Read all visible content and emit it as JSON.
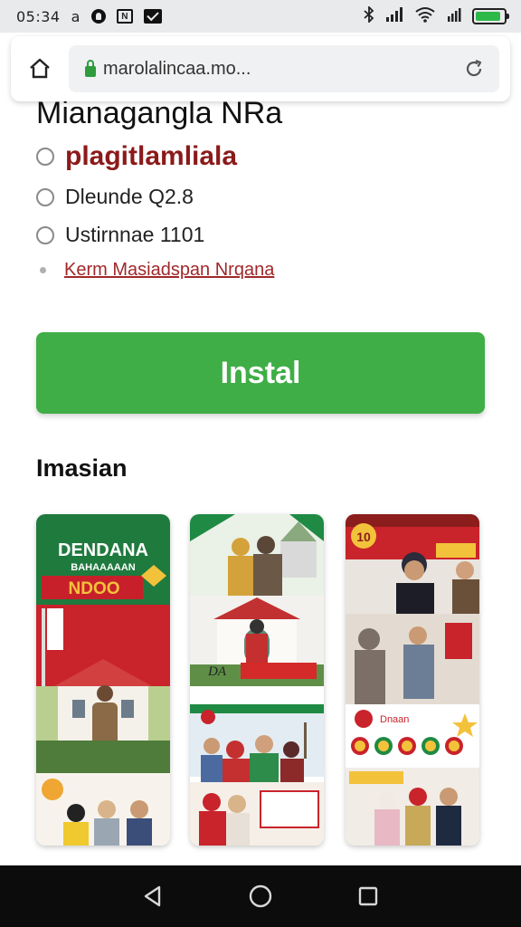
{
  "status_bar": {
    "time": "05:34",
    "letter": "a",
    "icons": [
      "notification-dot-icon",
      "n-box-icon",
      "mail-icon",
      "bluetooth-icon",
      "signal-icon",
      "wifi-icon",
      "battery-icon"
    ],
    "battery_level": 0.9
  },
  "browser": {
    "url": "marolalincaa.mo...",
    "home_icon": "home-icon",
    "reload_icon": "reload-icon"
  },
  "page": {
    "title": "Mianagangla NRa",
    "options": [
      {
        "label": "plagitlamliala"
      },
      {
        "label": "Dleunde Q2.8"
      },
      {
        "label": "Ustirnnae 1101"
      }
    ],
    "link": "Kerm Masiadspan Nrqana",
    "install_label": "Instal",
    "screenshots_title": "Imasian",
    "screenshot_texts": {
      "s1_title": "DENDANA",
      "s1_sub": "BAHAAAAAN",
      "s1_badge": "NDOO",
      "s2_banner": "DA",
      "s3_num": "10",
      "s3_text": "Dnaan"
    }
  },
  "colors": {
    "install_green": "#3fae46",
    "link_red": "#a0282a",
    "option_red": "#8b1a1a",
    "status_bg": "#e9eaec",
    "nav_bg": "#0c0c0c"
  },
  "nav": {
    "back_icon": "back-triangle-icon",
    "home_icon": "home-circle-icon",
    "recents_icon": "recents-square-icon"
  }
}
